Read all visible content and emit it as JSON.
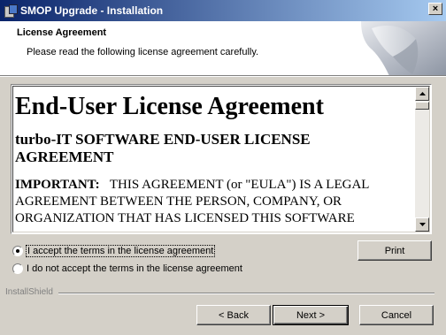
{
  "window": {
    "title": "SMOP Upgrade - Installation",
    "close_glyph": "×"
  },
  "banner": {
    "title": "License Agreement",
    "subtitle": "Please read the following license agreement carefully."
  },
  "eula": {
    "heading": "End-User License Agreement",
    "subheading": "turbo-IT SOFTWARE END-USER LICENSE AGREEMENT",
    "important_label": "IMPORTANT:",
    "important_text": "THIS AGREEMENT (or \"EULA\") IS A LEGAL AGREEMENT BETWEEN THE PERSON, COMPANY, OR ORGANIZATION THAT HAS LICENSED THIS SOFTWARE"
  },
  "options": {
    "accept_label": "I accept the terms in the license agreement",
    "decline_label": "I do not accept the terms in the license agreement",
    "selected": "accept"
  },
  "buttons": {
    "print": "Print",
    "back": "< Back",
    "next": "Next >",
    "cancel": "Cancel"
  },
  "footer": {
    "brand": "InstallShield"
  },
  "colors": {
    "title_start": "#0a246a",
    "title_end": "#a6caf0",
    "dialog_bg": "#d4d0c8"
  }
}
